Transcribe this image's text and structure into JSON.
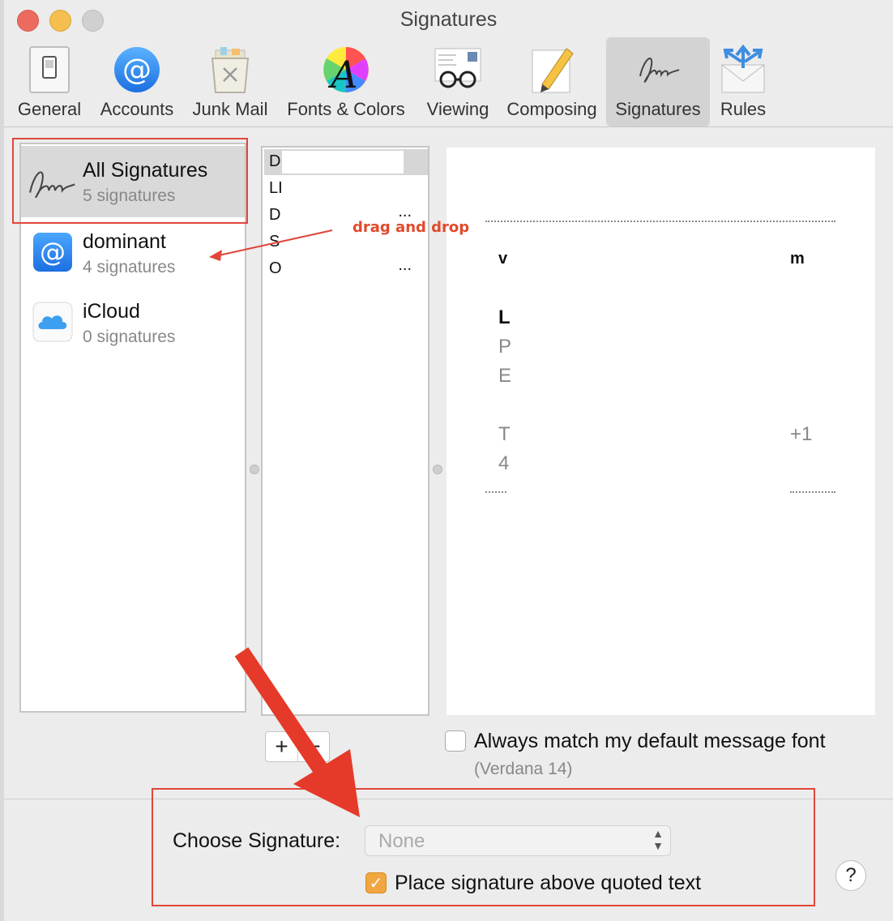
{
  "window": {
    "title": "Signatures"
  },
  "toolbar": {
    "tabs": [
      {
        "label": "General",
        "icon": "general-switch-icon"
      },
      {
        "label": "Accounts",
        "icon": "at-sign-icon"
      },
      {
        "label": "Junk Mail",
        "icon": "junk-trash-icon"
      },
      {
        "label": "Fonts & Colors",
        "icon": "font-color-wheel-icon"
      },
      {
        "label": "Viewing",
        "icon": "glasses-icon"
      },
      {
        "label": "Composing",
        "icon": "pencil-paper-icon"
      },
      {
        "label": "Signatures",
        "icon": "signature-icon",
        "selected": true
      },
      {
        "label": "Rules",
        "icon": "rules-envelope-icon"
      }
    ]
  },
  "accounts": [
    {
      "name": "All Signatures",
      "count": "5 signatures",
      "icon": "signature-icon",
      "selected": true
    },
    {
      "name": "dominant",
      "count": "4 signatures",
      "icon": "at-sign-icon"
    },
    {
      "name": "iCloud",
      "count": "0 signatures",
      "icon": "icloud-icon"
    }
  ],
  "signatures": [
    {
      "letter": "D",
      "ellipsis": "",
      "selected": true
    },
    {
      "letter": "LI",
      "ellipsis": ""
    },
    {
      "letter": "D",
      "ellipsis": "..."
    },
    {
      "letter": "S",
      "ellipsis": ""
    },
    {
      "letter": "O",
      "ellipsis": "..."
    }
  ],
  "preview": {
    "fragments": {
      "w": "v",
      "m": "m",
      "l": "L",
      "p": "P",
      "e": "E",
      "t": "T",
      "plus1": "+1",
      "four": "4"
    }
  },
  "buttons": {
    "add": "+",
    "remove": "−"
  },
  "options": {
    "match_font_label": "Always match my default message font",
    "match_font_sub": "(Verdana 14)",
    "match_font_checked": false,
    "choose_label": "Choose Signature:",
    "choose_value": "None",
    "place_above_label": "Place signature above quoted text",
    "place_above_checked": true
  },
  "help": "?",
  "annotation": {
    "drag_text": "drag and drop"
  },
  "colors": {
    "annotation_red": "#e0463a",
    "checkbox_orange": "#f1a640",
    "selection_gray": "#d3d3d3"
  }
}
